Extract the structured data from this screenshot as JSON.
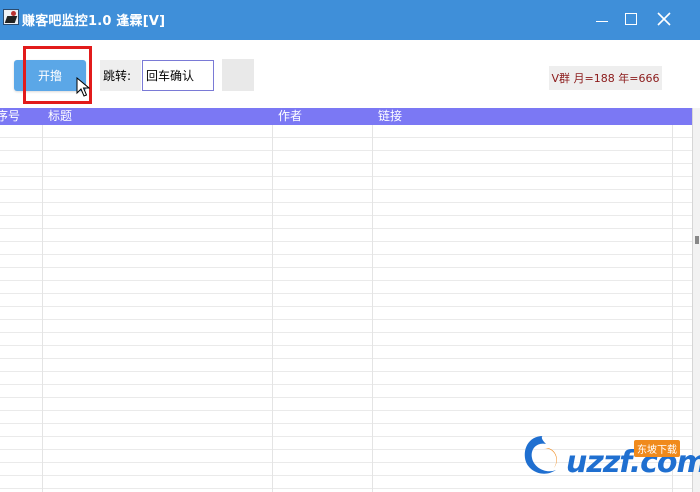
{
  "window": {
    "title": "赚客吧监控1.0 逢霖[V]",
    "icon": "app-logo-icon",
    "controls": [
      "minimize-icon",
      "maximize-icon",
      "close-icon"
    ]
  },
  "toolbar": {
    "start_label": "开撸",
    "jump_label": "跳转:",
    "jump_value": "回车确认",
    "v_badge": "V群 月=188 年=666"
  },
  "table": {
    "columns": [
      "序号",
      "标题",
      "作者",
      "链接"
    ],
    "rows": []
  },
  "watermark": {
    "text": "uzzf.com",
    "badge": "东坡下载"
  },
  "colors": {
    "titlebar": "#3f8fd9",
    "start_button": "#5ba7e7",
    "table_header": "#7b78f4",
    "highlight": "#e21b1b",
    "badge_text": "#8b1a1a"
  }
}
